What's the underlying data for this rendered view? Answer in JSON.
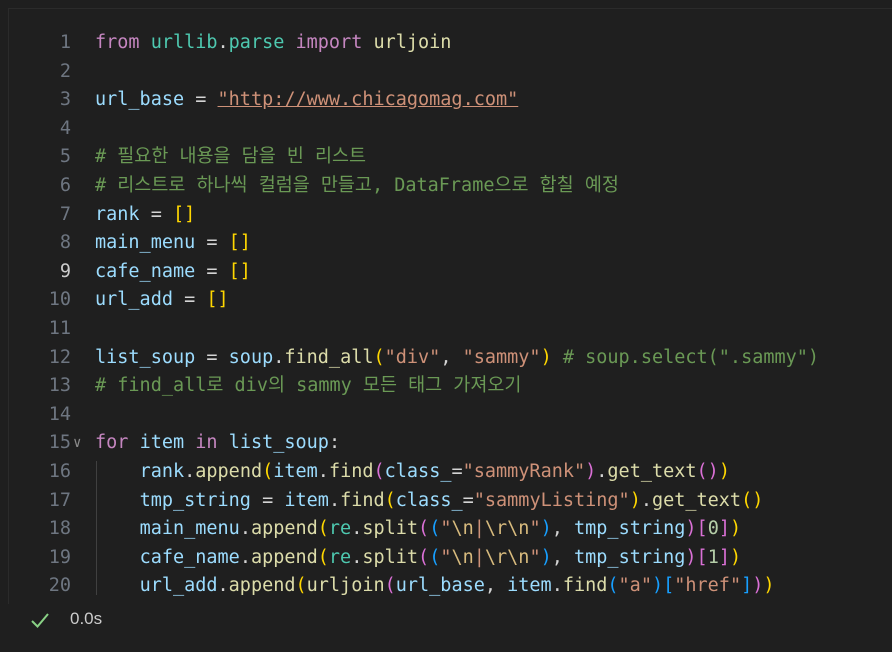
{
  "editor": {
    "language": "python",
    "active_line": 9,
    "lines": [
      {
        "n": "1",
        "tokens": [
          [
            "kw",
            "from"
          ],
          [
            "op",
            " "
          ],
          [
            "mod",
            "urllib"
          ],
          [
            "op",
            "."
          ],
          [
            "mod",
            "parse"
          ],
          [
            "op",
            " "
          ],
          [
            "kw",
            "import"
          ],
          [
            "op",
            " "
          ],
          [
            "fn",
            "urljoin"
          ]
        ]
      },
      {
        "n": "2",
        "tokens": []
      },
      {
        "n": "3",
        "tokens": [
          [
            "var",
            "url_base"
          ],
          [
            "op",
            " = "
          ],
          [
            "str url",
            "\"http://www.chicagomag.com\""
          ]
        ]
      },
      {
        "n": "4",
        "tokens": []
      },
      {
        "n": "5",
        "tokens": [
          [
            "cmt",
            "# 필요한 내용을 담을 빈 리스트"
          ]
        ]
      },
      {
        "n": "6",
        "tokens": [
          [
            "cmt",
            "# 리스트로 하나씩 컬럼을 만들고, DataFrame으로 합칠 예정"
          ]
        ]
      },
      {
        "n": "7",
        "tokens": [
          [
            "var",
            "rank"
          ],
          [
            "op",
            " = "
          ],
          [
            "p1",
            "[]"
          ]
        ]
      },
      {
        "n": "8",
        "tokens": [
          [
            "var",
            "main_menu"
          ],
          [
            "op",
            " = "
          ],
          [
            "p1",
            "[]"
          ]
        ]
      },
      {
        "n": "9",
        "tokens": [
          [
            "var",
            "cafe_name"
          ],
          [
            "op",
            " = "
          ],
          [
            "p1",
            "[]"
          ]
        ]
      },
      {
        "n": "10",
        "tokens": [
          [
            "var",
            "url_add"
          ],
          [
            "op",
            " = "
          ],
          [
            "p1",
            "[]"
          ]
        ]
      },
      {
        "n": "11",
        "tokens": []
      },
      {
        "n": "12",
        "tokens": [
          [
            "var",
            "list_soup"
          ],
          [
            "op",
            " = "
          ],
          [
            "var",
            "soup"
          ],
          [
            "op",
            "."
          ],
          [
            "fn",
            "find_all"
          ],
          [
            "p1",
            "("
          ],
          [
            "str",
            "\"div\""
          ],
          [
            "op",
            ", "
          ],
          [
            "str",
            "\"sammy\""
          ],
          [
            "p1",
            ")"
          ],
          [
            "op",
            " "
          ],
          [
            "cmt",
            "# soup.select(\".sammy\")"
          ]
        ]
      },
      {
        "n": "13",
        "tokens": [
          [
            "cmt",
            "# find_all로 div의 sammy 모든 태그 가져오기"
          ]
        ]
      },
      {
        "n": "14",
        "tokens": []
      },
      {
        "n": "15",
        "fold": true,
        "tokens": [
          [
            "kw",
            "for"
          ],
          [
            "op",
            " "
          ],
          [
            "var",
            "item"
          ],
          [
            "op",
            " "
          ],
          [
            "kw",
            "in"
          ],
          [
            "op",
            " "
          ],
          [
            "var",
            "list_soup"
          ],
          [
            "op",
            ":"
          ]
        ]
      },
      {
        "n": "16",
        "tokens": [
          [
            "op",
            "    "
          ],
          [
            "var",
            "rank"
          ],
          [
            "op",
            "."
          ],
          [
            "fn",
            "append"
          ],
          [
            "p1",
            "("
          ],
          [
            "var",
            "item"
          ],
          [
            "op",
            "."
          ],
          [
            "fn",
            "find"
          ],
          [
            "p2",
            "("
          ],
          [
            "var",
            "class_"
          ],
          [
            "op",
            "="
          ],
          [
            "str",
            "\"sammyRank\""
          ],
          [
            "p2",
            ")"
          ],
          [
            "op",
            "."
          ],
          [
            "fn",
            "get_text"
          ],
          [
            "p2",
            "()"
          ],
          [
            "p1",
            ")"
          ]
        ]
      },
      {
        "n": "17",
        "tokens": [
          [
            "op",
            "    "
          ],
          [
            "var",
            "tmp_string"
          ],
          [
            "op",
            " = "
          ],
          [
            "var",
            "item"
          ],
          [
            "op",
            "."
          ],
          [
            "fn",
            "find"
          ],
          [
            "p1",
            "("
          ],
          [
            "var",
            "class_"
          ],
          [
            "op",
            "="
          ],
          [
            "str",
            "\"sammyListing\""
          ],
          [
            "p1",
            ")"
          ],
          [
            "op",
            "."
          ],
          [
            "fn",
            "get_text"
          ],
          [
            "p1",
            "()"
          ]
        ]
      },
      {
        "n": "18",
        "tokens": [
          [
            "op",
            "    "
          ],
          [
            "var",
            "main_menu"
          ],
          [
            "op",
            "."
          ],
          [
            "fn",
            "append"
          ],
          [
            "p1",
            "("
          ],
          [
            "mod",
            "re"
          ],
          [
            "op",
            "."
          ],
          [
            "fn",
            "split"
          ],
          [
            "p2",
            "("
          ],
          [
            "p3",
            "("
          ],
          [
            "str",
            "\""
          ],
          [
            "esc",
            "\\n"
          ],
          [
            "str",
            "|"
          ],
          [
            "esc",
            "\\r\\n"
          ],
          [
            "str",
            "\""
          ],
          [
            "p3",
            ")"
          ],
          [
            "op",
            ", "
          ],
          [
            "var",
            "tmp_string"
          ],
          [
            "p2",
            ")"
          ],
          [
            "p2",
            "["
          ],
          [
            "num",
            "0"
          ],
          [
            "p2",
            "]"
          ],
          [
            "p1",
            ")"
          ]
        ]
      },
      {
        "n": "19",
        "tokens": [
          [
            "op",
            "    "
          ],
          [
            "var",
            "cafe_name"
          ],
          [
            "op",
            "."
          ],
          [
            "fn",
            "append"
          ],
          [
            "p1",
            "("
          ],
          [
            "mod",
            "re"
          ],
          [
            "op",
            "."
          ],
          [
            "fn",
            "split"
          ],
          [
            "p2",
            "("
          ],
          [
            "p3",
            "("
          ],
          [
            "str",
            "\""
          ],
          [
            "esc",
            "\\n"
          ],
          [
            "str",
            "|"
          ],
          [
            "esc",
            "\\r\\n"
          ],
          [
            "str",
            "\""
          ],
          [
            "p3",
            ")"
          ],
          [
            "op",
            ", "
          ],
          [
            "var",
            "tmp_string"
          ],
          [
            "p2",
            ")"
          ],
          [
            "p2",
            "["
          ],
          [
            "num",
            "1"
          ],
          [
            "p2",
            "]"
          ],
          [
            "p1",
            ")"
          ]
        ]
      },
      {
        "n": "20",
        "tokens": [
          [
            "op",
            "    "
          ],
          [
            "var",
            "url_add"
          ],
          [
            "op",
            "."
          ],
          [
            "fn",
            "append"
          ],
          [
            "p1",
            "("
          ],
          [
            "fn",
            "urljoin"
          ],
          [
            "p2",
            "("
          ],
          [
            "var",
            "url_base"
          ],
          [
            "op",
            ", "
          ],
          [
            "var",
            "item"
          ],
          [
            "op",
            "."
          ],
          [
            "fn",
            "find"
          ],
          [
            "p3",
            "("
          ],
          [
            "str",
            "\"a\""
          ],
          [
            "p3",
            ")"
          ],
          [
            "p3",
            "["
          ],
          [
            "str",
            "\"href\""
          ],
          [
            "p3",
            "]"
          ],
          [
            "p2",
            ")"
          ],
          [
            "p1",
            ")"
          ]
        ]
      }
    ]
  },
  "status": {
    "icon": "checkmark-icon",
    "check_color": "#89d185",
    "time": "0.0s"
  }
}
